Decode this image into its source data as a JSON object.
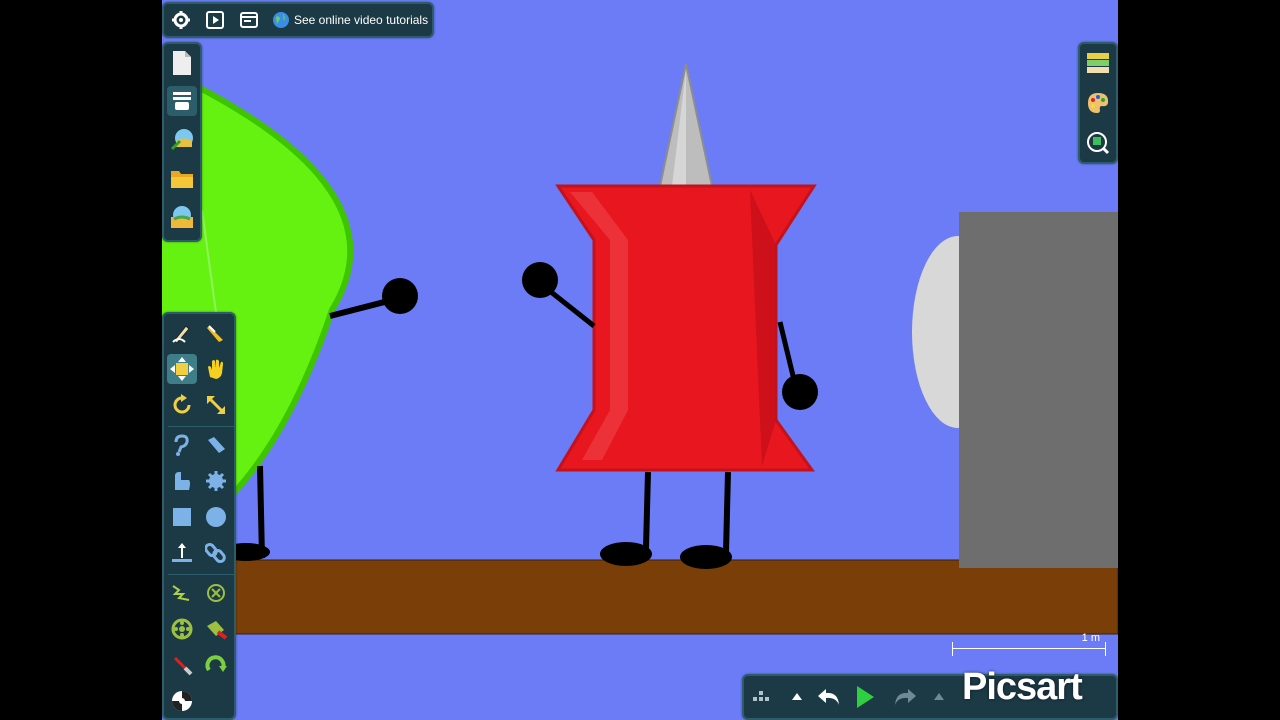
{
  "top_toolbar": {
    "settings_icon": "gear-icon",
    "play_icon": "play-icon",
    "window_icon": "window-icon",
    "tutorial_link": "See online video tutorials"
  },
  "file_toolbar": {
    "items": [
      "new-document-icon",
      "scene-menu-icon",
      "export-icon",
      "open-folder-icon",
      "save-icon"
    ]
  },
  "tool_palette": {
    "groups": [
      [
        "draw-tool",
        "knife-tool",
        "move-tool",
        "grab-tool",
        "rotate-tool",
        "scale-tool"
      ],
      [
        "rope-tool",
        "fixate-tool",
        "polygon-tool",
        "gear-tool",
        "box-tool",
        "circle-tool",
        "plane-tool",
        "chain-tool"
      ],
      [
        "spring-tool",
        "hinge-cancel-tool",
        "axle-tool",
        "laser-tool",
        "tracer-tool",
        "thruster-tool",
        "spiral-tool"
      ]
    ],
    "active_tool": "move-tool"
  },
  "right_toolbar": {
    "items": [
      "background-icon",
      "palette-icon",
      "zoom-icon"
    ]
  },
  "bottom_bar": {
    "items": [
      "grid-menu-icon",
      "caret-up-icon",
      "undo-icon",
      "play-icon",
      "redo-icon",
      "caret-up-icon-2"
    ]
  },
  "scale_indicator": {
    "label": "1 m"
  },
  "watermark": "Picsart",
  "colors": {
    "sky": "#6b7cf6",
    "ground": "#7a3f08",
    "pin_red": "#e8161e",
    "leaf_green": "#66f210",
    "panel": "#1c3a45",
    "wall_gray": "#6e6e6e"
  }
}
